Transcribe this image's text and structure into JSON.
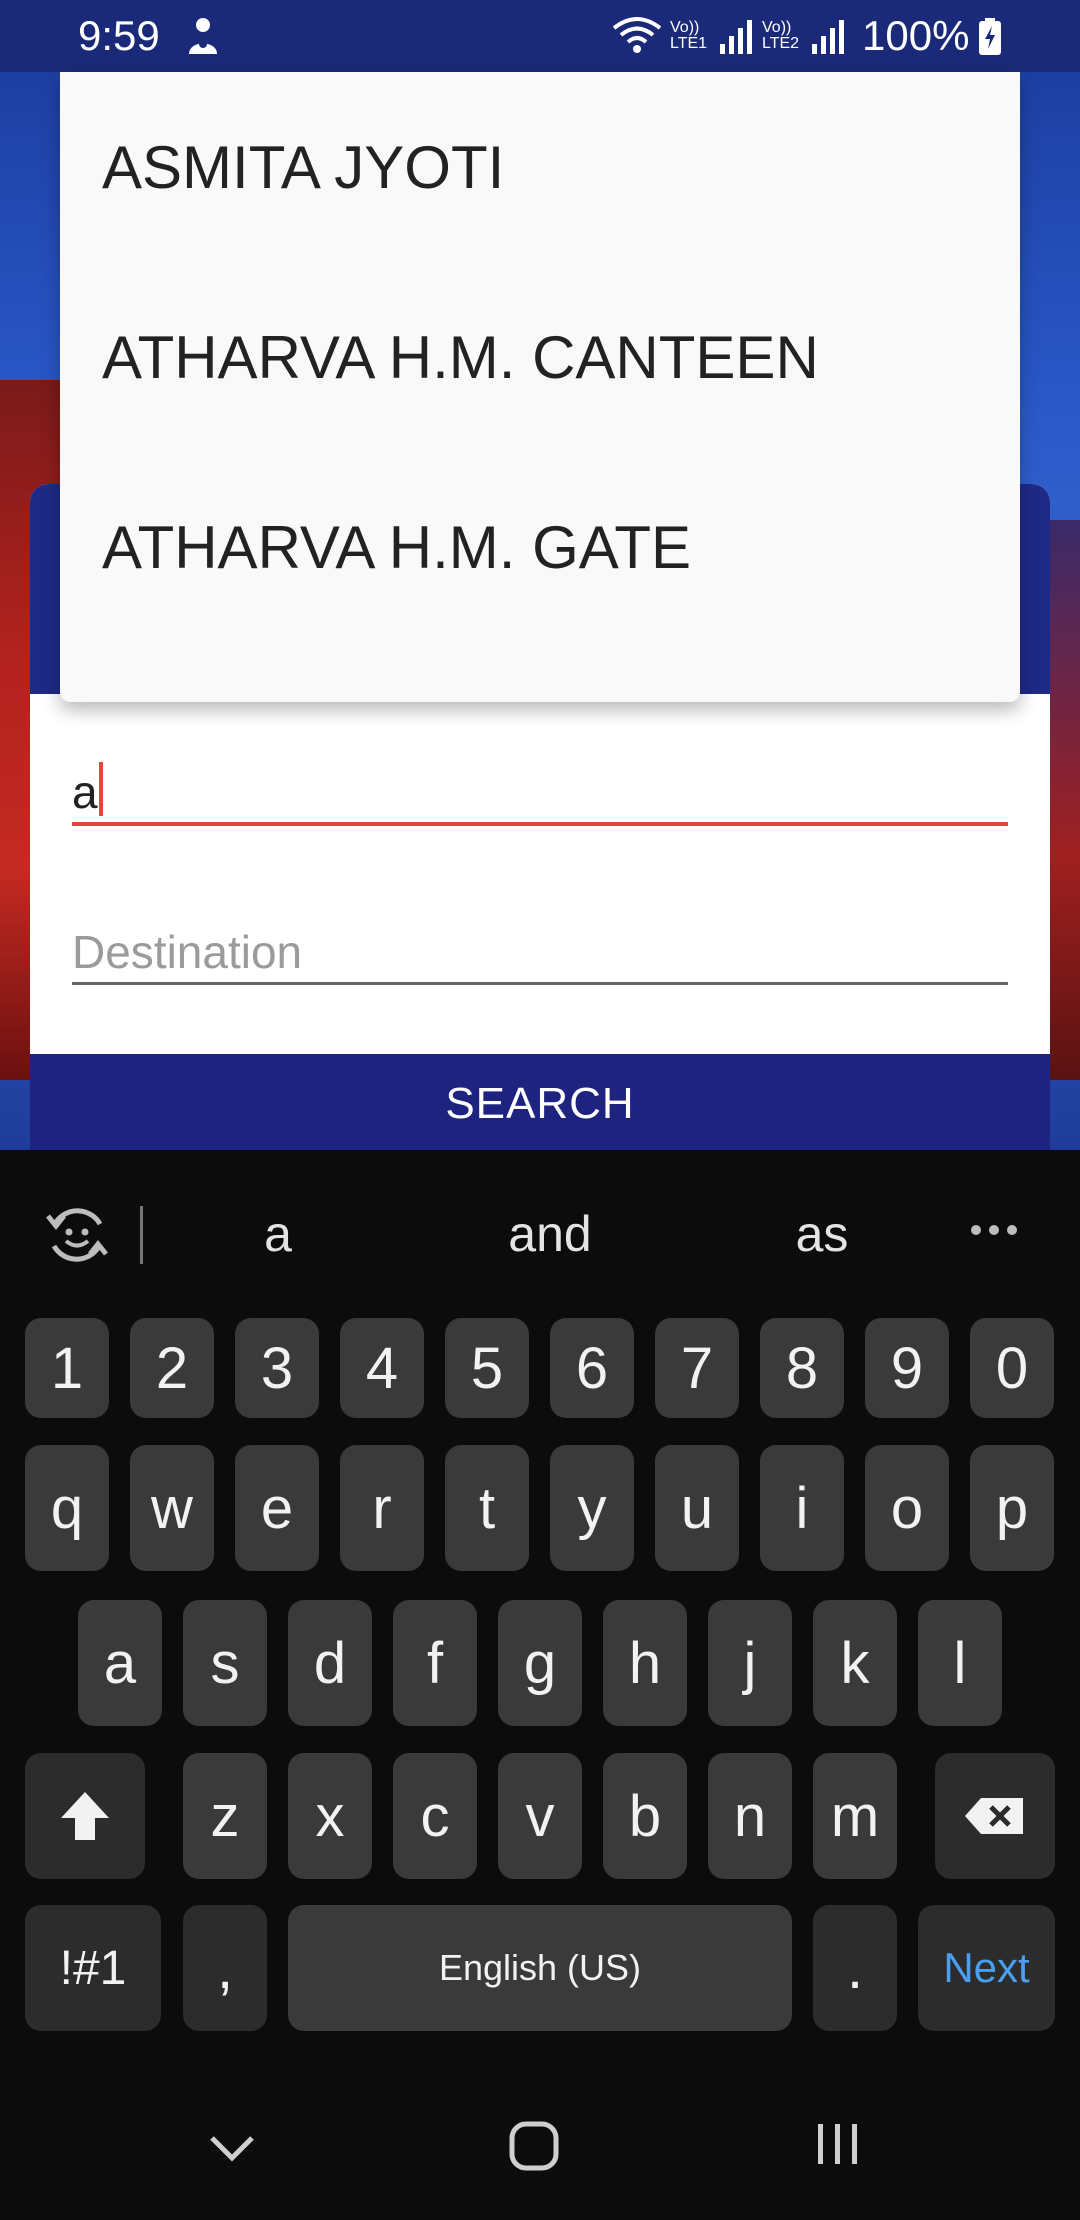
{
  "status_bar": {
    "time": "9:59",
    "battery": "100%",
    "sim1": "Vo)) LTE1",
    "sim2": "Vo)) LTE2"
  },
  "dropdown": {
    "items": [
      "ASMITA JYOTI",
      "ATHARVA H.M. CANTEEN",
      "ATHARVA H.M. GATE"
    ]
  },
  "form": {
    "source_value": "a",
    "destination_placeholder": "Destination",
    "search_label": "SEARCH"
  },
  "keyboard": {
    "suggestions": [
      "a",
      "and",
      "as"
    ],
    "number_row": [
      "1",
      "2",
      "3",
      "4",
      "5",
      "6",
      "7",
      "8",
      "9",
      "0"
    ],
    "row1": [
      "q",
      "w",
      "e",
      "r",
      "t",
      "y",
      "u",
      "i",
      "o",
      "p"
    ],
    "row2": [
      "a",
      "s",
      "d",
      "f",
      "g",
      "h",
      "j",
      "k",
      "l"
    ],
    "row3": [
      "z",
      "x",
      "c",
      "v",
      "b",
      "n",
      "m"
    ],
    "symbols_label": "!#1",
    "comma_label": ",",
    "space_label": "English (US)",
    "period_label": ".",
    "next_label": "Next",
    "accent_color": "#4a9ff0"
  },
  "icons": {
    "status": [
      "person-icon",
      "wifi-icon",
      "signal-icon",
      "battery-icon"
    ],
    "keyboard": [
      "emoji-refresh-icon",
      "more-icon",
      "shift-icon",
      "backspace-icon"
    ],
    "nav": [
      "nav-back-icon",
      "nav-home-icon",
      "nav-recents-icon"
    ]
  }
}
